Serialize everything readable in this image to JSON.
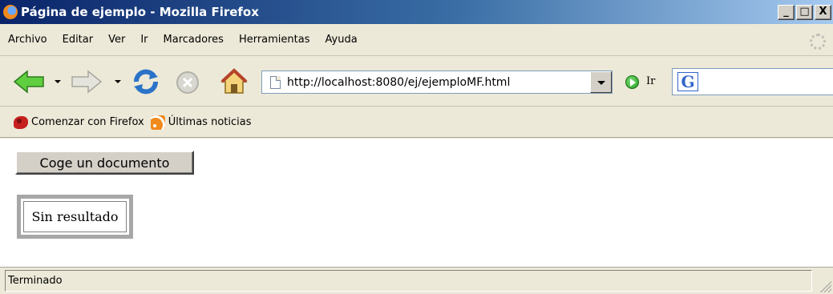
{
  "window": {
    "title": "Página de ejemplo - Mozilla Firefox",
    "minimize": "_",
    "maximize": "□",
    "close": "X"
  },
  "menu": {
    "items": [
      "Archivo",
      "Editar",
      "Ver",
      "Ir",
      "Marcadores",
      "Herramientas",
      "Ayuda"
    ]
  },
  "navbar": {
    "url": "http://localhost:8080/ej/ejemploMF.html",
    "go_label": "Ir",
    "search_engine_icon": "G"
  },
  "bookmarks": {
    "items": [
      {
        "label": "Comenzar con Firefox",
        "icon": "firefox-icon"
      },
      {
        "label": "Últimas noticias",
        "icon": "rss-icon"
      }
    ]
  },
  "content": {
    "button_label": "Coge un documento",
    "result_text": "Sin resultado"
  },
  "status": {
    "text": "Terminado"
  },
  "colors": {
    "titlebar_start": "#0a246a",
    "titlebar_end": "#a6caf0",
    "chrome": "#ece9d8"
  }
}
